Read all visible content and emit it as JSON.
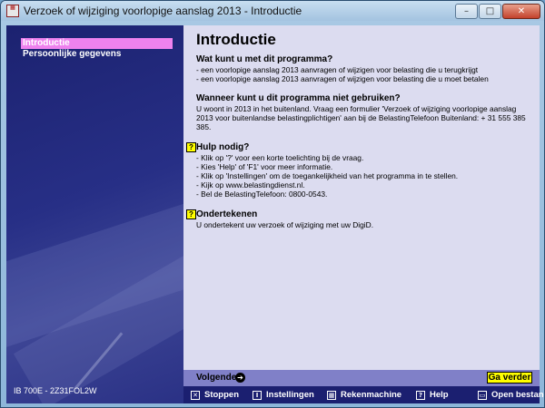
{
  "window": {
    "title": "Verzoek of wijziging voorlopige aanslag 2013 - Introductie",
    "minimize": "–",
    "maximize": "□",
    "close": "✕"
  },
  "sidebar": {
    "items": [
      {
        "label": "Introductie",
        "active": true
      },
      {
        "label": "Persoonlijke gegevens",
        "active": false
      }
    ],
    "version": "IB 700E - 2Z31FOL2W"
  },
  "content": {
    "heading": "Introductie",
    "sections": [
      {
        "title": "Wat kunt u met dit programma?",
        "lines": [
          "- een voorlopige aanslag 2013 aanvragen of wijzigen voor belasting die u terugkrijgt",
          "- een voorlopige aanslag 2013 aanvragen of wijzigen voor belasting die u moet betalen"
        ]
      },
      {
        "title": "Wanneer kunt u dit programma niet gebruiken?",
        "lines": [
          "U woont in 2013 in het buitenland. Vraag een formulier 'Verzoek of wijziging voorlopige aanslag",
          "2013 voor buitenlandse belastingplichtigen' aan bij de BelastingTelefoon Buitenland: + 31 555 385",
          "385."
        ]
      },
      {
        "title": "Hulp nodig?",
        "icon": "?",
        "lines": [
          "- Klik op '?' voor een korte toelichting bij de vraag.",
          "- Kies 'Help' of 'F1' voor meer informatie.",
          "- Klik op 'Instellingen' om de toegankelijkheid van het programma in te stellen.",
          "- Kijk op www.belastingdienst.nl.",
          "- Bel de BelastingTelefoon: 0800-0543."
        ]
      },
      {
        "title": "Ondertekenen",
        "icon": "?",
        "lines": [
          "U ondertekent uw verzoek of wijziging met uw DigiD."
        ]
      }
    ]
  },
  "nav": {
    "next_label": "Volgende",
    "next_arrow": "➔",
    "go_label": "Ga verder"
  },
  "toolbar": {
    "stop": {
      "label": "Stoppen",
      "icon": "✕"
    },
    "settings": {
      "label": "Instellingen",
      "icon": "I"
    },
    "calculator": {
      "label": "Rekenmachine",
      "icon": "▦"
    },
    "help": {
      "label": "Help",
      "icon": "?"
    },
    "open": {
      "label": "Open bestand",
      "icon": "▭"
    }
  }
}
